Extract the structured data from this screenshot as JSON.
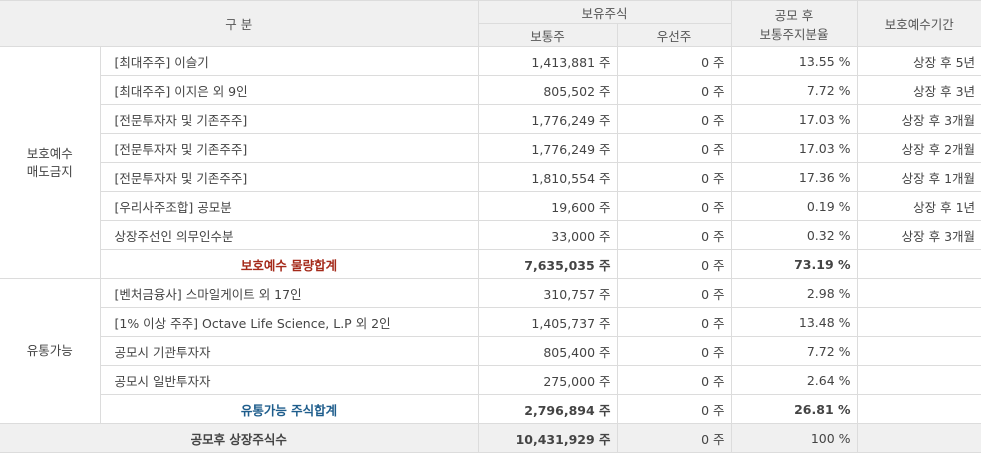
{
  "header": {
    "category": "구 분",
    "held_shares": "보유주식",
    "common": "보통주",
    "preferred": "우선주",
    "ratio": [
      "공모 후",
      "보통주지분율"
    ],
    "lockup_period": "보호예수기간"
  },
  "groups": [
    {
      "label": [
        "보호예수",
        "매도금지"
      ],
      "rows": [
        {
          "name": "[최대주주] 이슬기",
          "common": "1,413,881 주",
          "preferred": "0 주",
          "ratio": "13.55 %",
          "period": "상장 후 5년"
        },
        {
          "name": "[최대주주] 이지은 외 9인",
          "common": "805,502 주",
          "preferred": "0 주",
          "ratio": "7.72 %",
          "period": "상장 후 3년"
        },
        {
          "name": "[전문투자자 및 기존주주]",
          "common": "1,776,249 주",
          "preferred": "0 주",
          "ratio": "17.03 %",
          "period": "상장 후 3개월"
        },
        {
          "name": "[전문투자자 및 기존주주]",
          "common": "1,776,249 주",
          "preferred": "0 주",
          "ratio": "17.03 %",
          "period": "상장 후 2개월"
        },
        {
          "name": "[전문투자자 및 기존주주]",
          "common": "1,810,554 주",
          "preferred": "0 주",
          "ratio": "17.36 %",
          "period": "상장 후 1개월"
        },
        {
          "name": "[우리사주조합] 공모분",
          "common": "19,600 주",
          "preferred": "0 주",
          "ratio": "0.19 %",
          "period": "상장 후 1년"
        },
        {
          "name": "상장주선인 의무인수분",
          "common": "33,000 주",
          "preferred": "0 주",
          "ratio": "0.32 %",
          "period": "상장 후 3개월"
        }
      ],
      "subtotal": {
        "name": "보호예수 물량합계",
        "common": "7,635,035 주",
        "preferred": "0 주",
        "ratio": "73.19 %",
        "period": "",
        "color": "#a52a1a"
      }
    },
    {
      "label": [
        "유통가능"
      ],
      "rows": [
        {
          "name": "[벤처금융사] 스마일게이트 외 17인",
          "common": "310,757 주",
          "preferred": "0 주",
          "ratio": "2.98 %",
          "period": ""
        },
        {
          "name": "[1% 이상 주주] Octave Life Science, L.P 외 2인",
          "common": "1,405,737 주",
          "preferred": "0 주",
          "ratio": "13.48 %",
          "period": ""
        },
        {
          "name": "공모시 기관투자자",
          "common": "805,400 주",
          "preferred": "0 주",
          "ratio": "7.72 %",
          "period": ""
        },
        {
          "name": "공모시 일반투자자",
          "common": "275,000 주",
          "preferred": "0 주",
          "ratio": "2.64 %",
          "period": ""
        }
      ],
      "subtotal": {
        "name": "유통가능 주식합계",
        "common": "2,796,894 주",
        "preferred": "0 주",
        "ratio": "26.81 %",
        "period": "",
        "color": "#1e5d8c"
      }
    }
  ],
  "total": {
    "name": "공모후 상장주식수",
    "common": "10,431,929 주",
    "preferred": "0 주",
    "ratio": "100 %",
    "period": ""
  }
}
